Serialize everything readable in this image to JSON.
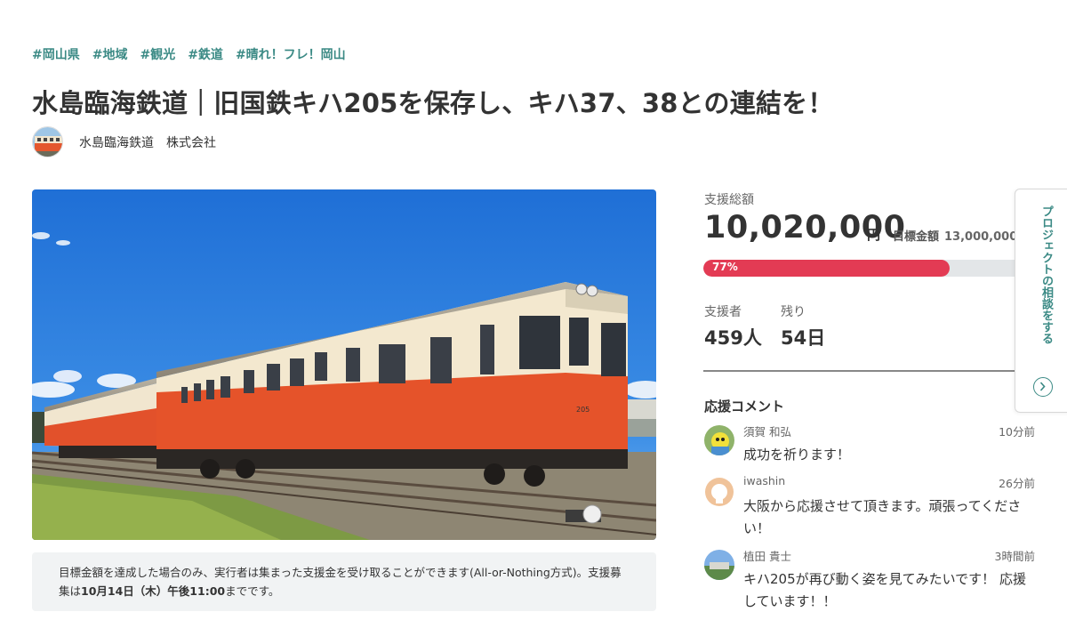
{
  "tags": [
    "#岡山県",
    "#地域",
    "#観光",
    "#鉄道",
    "#晴れ！フレ！岡山"
  ],
  "title": "水島臨海鉄道｜旧国鉄キハ205を保存し、キハ37、38との連結を！",
  "owner": {
    "name": "水島臨海鉄道　株式会社"
  },
  "hero": {
    "car_number": "205"
  },
  "notice": {
    "text_before": "目標金額を達成した場合のみ、実行者は集まった支援金を受け取ることができます(All-or-Nothing方式)。支援募集は",
    "deadline": "10月14日（木）午後11:00",
    "text_after": "までです。"
  },
  "stats": {
    "total_label": "支援総額",
    "total_amount": "10,020,000",
    "yen": "円",
    "goal_label": "目標金額",
    "goal_amount": "13,000,000円",
    "progress_text": "77%",
    "progress_fraction": 0.77,
    "supporters_label": "支援者",
    "supporters_value": "459人",
    "remaining_label": "残り",
    "remaining_value": "54日"
  },
  "comments_title": "応援コメント",
  "comments": [
    {
      "name": "須賀 和弘",
      "time": "10分前",
      "text": "成功を祈ります！"
    },
    {
      "name": "iwashin",
      "time": "26分前",
      "text": "大阪から応援させて頂きます。頑張ってください！"
    },
    {
      "name": "植田 貴士",
      "time": "3時間前",
      "text": "キハ205が再び動く姿を見てみたいです！ 応援しています！！"
    }
  ],
  "side_tab": {
    "label": "プロジェクトの相談をする",
    "icon": "chevron-right-icon"
  },
  "colors": {
    "accent": "#3b8a85",
    "progress": "#e33b54"
  }
}
